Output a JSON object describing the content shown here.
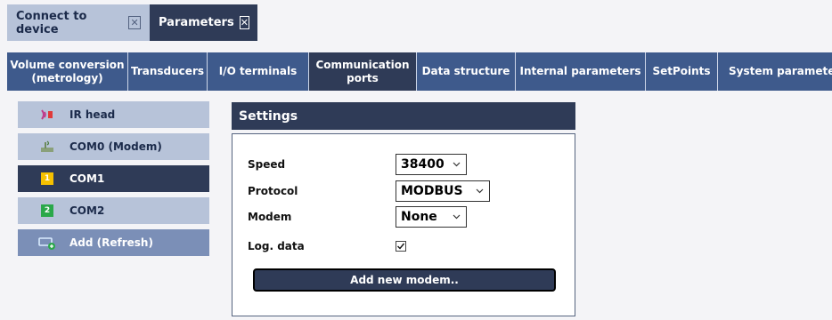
{
  "top_tabs": [
    {
      "label": "Connect to device",
      "close": "✕"
    },
    {
      "label": "Parameters",
      "close": "✕"
    }
  ],
  "sub_tabs": [
    {
      "line1": "Volume conversion",
      "line2": "(metrology)"
    },
    {
      "line1": "Transducers"
    },
    {
      "line1": "I/O terminals"
    },
    {
      "line1": "Communication",
      "line2": "ports"
    },
    {
      "line1": "Data structure"
    },
    {
      "line1": "Internal parameters"
    },
    {
      "line1": "SetPoints"
    },
    {
      "line1": "System parameters"
    }
  ],
  "ports": [
    {
      "label": "IR head",
      "icon": "ir-head-icon"
    },
    {
      "label": "COM0 (Modem)",
      "icon": "modem-icon"
    },
    {
      "label": "COM1",
      "icon": "number-badge",
      "badge": "1",
      "badge_color": "#f5c000"
    },
    {
      "label": "COM2",
      "icon": "number-badge",
      "badge": "2",
      "badge_color": "#2aa84a"
    },
    {
      "label": "Add (Refresh)",
      "icon": "add-port-icon"
    }
  ],
  "settings": {
    "title": "Settings",
    "speed": {
      "label": "Speed",
      "value": "38400"
    },
    "protocol": {
      "label": "Protocol",
      "value": "MODBUS"
    },
    "modem": {
      "label": "Modem",
      "value": "None"
    },
    "log_data": {
      "label": "Log. data",
      "checked": true
    },
    "add_modem_button": "Add new modem.."
  },
  "colors": {
    "dark_navy": "#2f3b57",
    "tab_bar_blue": "#3e5a8c",
    "light_blue": "#b7c3d9",
    "action_blue": "#7b8fb7"
  }
}
